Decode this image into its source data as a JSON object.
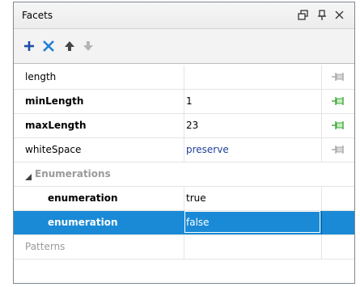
{
  "panel": {
    "title": "Facets",
    "controls": [
      "restore-icon",
      "pin-icon",
      "close-icon"
    ]
  },
  "toolbar": {
    "tools": [
      "add-icon",
      "remove-icon",
      "move-up-icon",
      "move-down-icon"
    ],
    "colors": {
      "add": "#1f4ea8",
      "remove": "#1f7fd6",
      "arrow": "#444444",
      "arrow_disabled": "#b5b5b5"
    }
  },
  "grid": {
    "rows": [
      {
        "name": "length",
        "value": "",
        "pinned": false
      },
      {
        "name": "minLength",
        "value": "1",
        "pinned": true
      },
      {
        "name": "maxLength",
        "value": "23",
        "pinned": true
      },
      {
        "name": "whiteSpace",
        "value": "preserve",
        "pinned": false
      }
    ],
    "group": {
      "label": "Enumerations",
      "expanded": true
    },
    "enumerations": [
      {
        "name": "enumeration",
        "value": "true"
      },
      {
        "name": "enumeration",
        "value": "false",
        "selected": true
      }
    ],
    "patterns_label": "Patterns"
  },
  "colors": {
    "selection": "#1a8ad6",
    "pin_active": "#3ea83e",
    "pin_inactive": "#a8a8a8"
  }
}
